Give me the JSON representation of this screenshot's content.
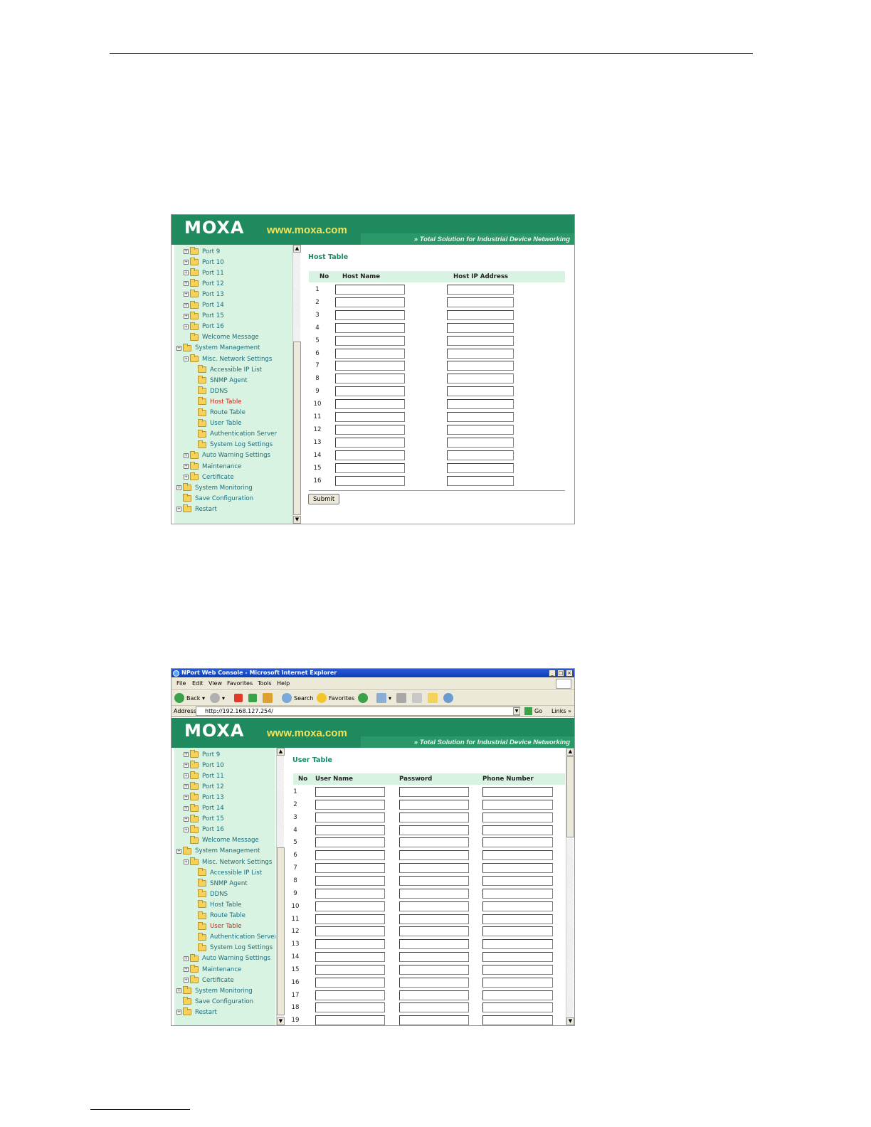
{
  "brand": {
    "logo": "MOXA",
    "url": "www.moxa.com",
    "slogan": "Total Solution for Industrial Device Networking"
  },
  "tree": [
    {
      "label": "Port 9",
      "expander": true,
      "level": 1
    },
    {
      "label": "Port 10",
      "expander": true,
      "level": 1
    },
    {
      "label": "Port 11",
      "expander": true,
      "level": 1
    },
    {
      "label": "Port 12",
      "expander": true,
      "level": 1
    },
    {
      "label": "Port 13",
      "expander": true,
      "level": 1
    },
    {
      "label": "Port 14",
      "expander": true,
      "level": 1
    },
    {
      "label": "Port 15",
      "expander": true,
      "level": 1
    },
    {
      "label": "Port 16",
      "expander": true,
      "level": 1
    },
    {
      "label": "Welcome Message",
      "expander": false,
      "level": 1
    },
    {
      "label": "System Management",
      "expander": true,
      "level": 0
    },
    {
      "label": "Misc. Network Settings",
      "expander": true,
      "level": 1
    },
    {
      "label": "Accessible IP List",
      "expander": false,
      "level": 2
    },
    {
      "label": "SNMP Agent",
      "expander": false,
      "level": 2
    },
    {
      "label": "DDNS",
      "expander": false,
      "level": 2
    },
    {
      "label": "Host Table",
      "expander": false,
      "level": 2
    },
    {
      "label": "Route Table",
      "expander": false,
      "level": 2
    },
    {
      "label": "User Table",
      "expander": false,
      "level": 2
    },
    {
      "label": "Authentication Server",
      "expander": false,
      "level": 2
    },
    {
      "label": "System Log Settings",
      "expander": false,
      "level": 2
    },
    {
      "label": "Auto Warning Settings",
      "expander": true,
      "level": 1
    },
    {
      "label": "Maintenance",
      "expander": true,
      "level": 1
    },
    {
      "label": "Certificate",
      "expander": true,
      "level": 1
    },
    {
      "label": "System Monitoring",
      "expander": true,
      "level": 0
    },
    {
      "label": "Save Configuration",
      "expander": false,
      "level": 0
    },
    {
      "label": "Restart",
      "expander": true,
      "level": 0
    }
  ],
  "host_table": {
    "title": "Host Table",
    "active_item": "Host Table",
    "columns": [
      "No",
      "Host Name",
      "Host IP Address"
    ],
    "rows": [
      "1",
      "2",
      "3",
      "4",
      "5",
      "6",
      "7",
      "8",
      "9",
      "10",
      "11",
      "12",
      "13",
      "14",
      "15",
      "16"
    ],
    "submit_label": "Submit"
  },
  "user_table": {
    "title": "User Table",
    "active_item": "User Table",
    "columns": [
      "No",
      "User Name",
      "Password",
      "Phone Number"
    ],
    "rows": [
      "1",
      "2",
      "3",
      "4",
      "5",
      "6",
      "7",
      "8",
      "9",
      "10",
      "11",
      "12",
      "13",
      "14",
      "15",
      "16",
      "17",
      "18",
      "19"
    ]
  },
  "browser": {
    "title": "NPort Web Console - Microsoft Internet Explorer",
    "menu": [
      "File",
      "Edit",
      "View",
      "Favorites",
      "Tools",
      "Help"
    ],
    "toolbar": {
      "back": "Back",
      "search": "Search",
      "favorites": "Favorites"
    },
    "address_label": "Address",
    "address_value": "http://192.168.127.254/",
    "go_label": "Go",
    "links_label": "Links"
  }
}
